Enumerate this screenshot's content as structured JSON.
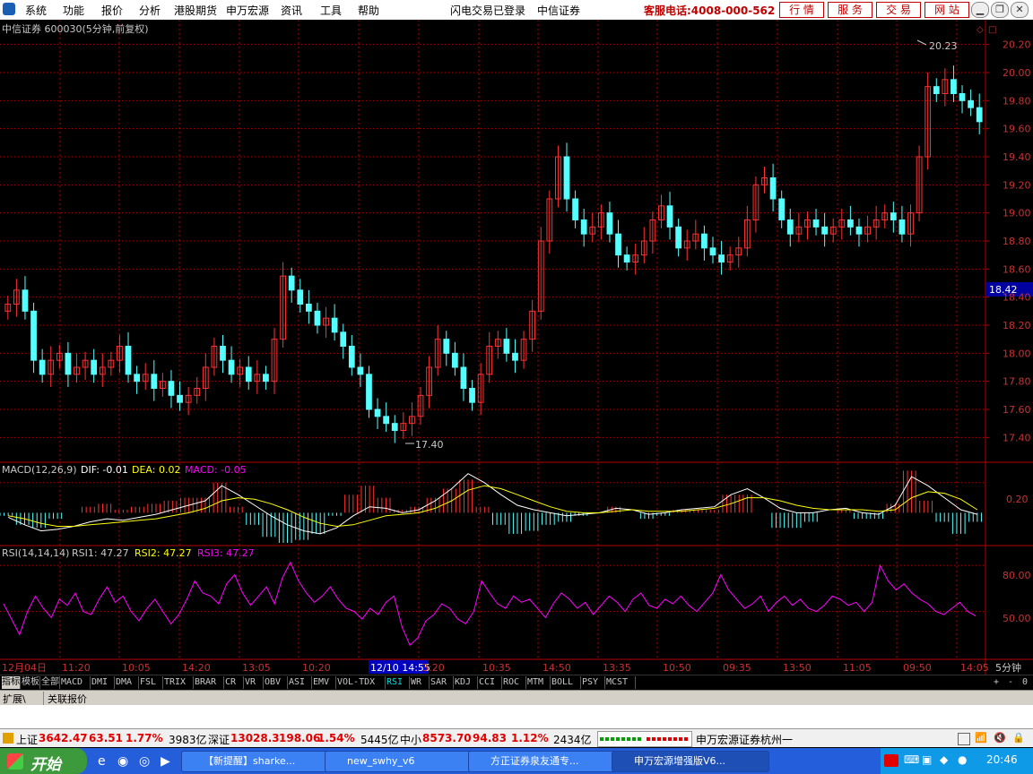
{
  "menu": {
    "items": [
      "系统",
      "功能",
      "报价",
      "分析",
      "港股期货",
      "申万宏源",
      "资讯",
      "工具",
      "帮助"
    ],
    "status": "闪电交易已登录",
    "broker": "中信证券",
    "hotline": "客服电话:4008-000-562",
    "service_buttons": [
      "行 情",
      "服 务",
      "交 易",
      "网 站"
    ]
  },
  "chart_header": "中信证券 600030(5分钟,前复权)",
  "price_panel": {
    "high_label": "20.23",
    "low_label": "17.40",
    "current_label": "18.42",
    "yticks": [
      "20.20",
      "20.00",
      "19.80",
      "19.60",
      "19.40",
      "19.20",
      "19.00",
      "18.80",
      "18.60",
      "18.40",
      "18.20",
      "18.00",
      "17.80",
      "17.60",
      "17.40"
    ]
  },
  "macd_panel": {
    "title": "MACD(12,26,9)",
    "dif": "DIF: -0.01",
    "dea": "DEA: 0.02",
    "macd": "MACD: -0.05",
    "ytick": "0.20"
  },
  "rsi_panel": {
    "title": "RSI(14,14,14)",
    "rsi1": "RSI1: 47.27",
    "rsi2": "RSI2: 47.27",
    "rsi3": "RSI3: 47.27",
    "yticks": [
      "80.00",
      "50.00"
    ]
  },
  "time_axis": {
    "labels": [
      "12月04日",
      "11:20",
      "10:05",
      "14:20",
      "13:05",
      "10:20",
      "12/10 14:55",
      "3:20",
      "10:35",
      "14:50",
      "13:35",
      "10:50",
      "09:35",
      "13:50",
      "11:05",
      "09:50",
      "14:05"
    ],
    "period": "5分钟"
  },
  "indicator_tabs": [
    "指标",
    "模板",
    "全部",
    "MACD",
    "DMI",
    "DMA",
    "FSL",
    "TRIX",
    "BRAR",
    "CR",
    "VR",
    "OBV",
    "ASI",
    "EMV",
    "VOL-TDX",
    "RSI",
    "WR",
    "SAR",
    "KDJ",
    "CCI",
    "ROC",
    "MTM",
    "BOLL",
    "PSY",
    "MCST"
  ],
  "tab_controls": [
    "+",
    "-",
    "0"
  ],
  "sub_tabs": [
    "扩展\\",
    "关联报价"
  ],
  "status_bar": {
    "sh_label": "上证",
    "sh_value": "3642.47",
    "sh_change": "63.51",
    "sh_pct": "1.77%",
    "sh_amount": "3983亿",
    "sz_label": "深证",
    "sz_value": "13028.3",
    "sz_change": "198.06",
    "sz_pct": "1.54%",
    "sz_amount": "5445亿",
    "zx_label": "中小",
    "zx_value": "8573.70",
    "zx_change": "94.83",
    "zx_pct": "1.12%",
    "zx_amount": "2434亿",
    "server": "申万宏源证券杭州一"
  },
  "taskbar": {
    "start": "开始",
    "tasks": [
      "【新提醒】sharke...",
      "new_swhy_v6",
      "方正证券泉友通专...",
      "申万宏源增强版V6..."
    ],
    "clock": "20:46"
  },
  "colors": {
    "up": "#ff3232",
    "down": "#54ffff",
    "grid": "#b40000",
    "axis_text": "#c83232",
    "dif": "#ffffff",
    "dea": "#ffff00",
    "rsi": "#ff00ff"
  },
  "chart_data": {
    "type": "candlestick",
    "price_ylim": [
      17.3,
      20.3
    ],
    "price_series": [
      18.35,
      18.45,
      18.3,
      17.95,
      17.85,
      17.95,
      18.0,
      17.85,
      17.9,
      17.95,
      17.85,
      17.9,
      17.95,
      18.05,
      17.85,
      17.8,
      17.85,
      17.75,
      17.8,
      17.7,
      17.65,
      17.7,
      17.75,
      17.9,
      18.05,
      17.95,
      17.85,
      17.9,
      17.8,
      17.85,
      17.8,
      18.1,
      18.55,
      18.45,
      18.35,
      18.3,
      18.2,
      18.25,
      18.15,
      18.05,
      17.9,
      17.85,
      17.6,
      17.55,
      17.5,
      17.45,
      17.5,
      17.55,
      17.7,
      17.9,
      18.1,
      18.0,
      17.9,
      17.75,
      17.65,
      17.85,
      18.05,
      18.1,
      18.0,
      17.95,
      18.1,
      18.3,
      18.8,
      19.1,
      19.4,
      19.1,
      18.95,
      18.85,
      18.9,
      19.0,
      18.85,
      18.7,
      18.65,
      18.7,
      18.8,
      18.95,
      19.05,
      18.9,
      18.75,
      18.8,
      18.85,
      18.75,
      18.7,
      18.65,
      18.7,
      18.75,
      18.95,
      19.2,
      19.25,
      19.1,
      18.95,
      18.85,
      18.9,
      18.95,
      18.9,
      18.85,
      18.9,
      18.95,
      18.9,
      18.85,
      18.9,
      18.95,
      19.0,
      18.95,
      18.85,
      19.0,
      19.4,
      19.9,
      19.85,
      19.95,
      19.85,
      19.8,
      19.75,
      19.65
    ],
    "macd_ylim": [
      -0.2,
      0.3
    ],
    "dif_series": [
      -0.03,
      -0.08,
      -0.12,
      -0.11,
      -0.09,
      -0.06,
      -0.04,
      -0.05,
      -0.03,
      -0.01,
      0.02,
      0.05,
      0.08,
      0.18,
      0.12,
      0.05,
      -0.02,
      -0.08,
      -0.12,
      -0.14,
      -0.1,
      -0.02,
      0.04,
      0.03,
      0.0,
      0.02,
      0.08,
      0.16,
      0.26,
      0.2,
      0.12,
      0.05,
      0.02,
      0.0,
      -0.02,
      -0.01,
      0.0,
      0.03,
      0.02,
      -0.01,
      0.0,
      0.02,
      0.03,
      0.04,
      0.12,
      0.16,
      0.1,
      0.03,
      0.0,
      0.0,
      0.02,
      0.03,
      0.0,
      -0.01,
      0.05,
      0.24,
      0.18,
      0.1,
      0.02,
      -0.01
    ],
    "dea_series": [
      -0.02,
      -0.04,
      -0.07,
      -0.09,
      -0.09,
      -0.08,
      -0.07,
      -0.06,
      -0.05,
      -0.04,
      -0.02,
      0.0,
      0.03,
      0.08,
      0.1,
      0.09,
      0.06,
      0.02,
      -0.03,
      -0.07,
      -0.09,
      -0.08,
      -0.05,
      -0.02,
      -0.01,
      0.0,
      0.03,
      0.08,
      0.15,
      0.18,
      0.16,
      0.12,
      0.08,
      0.04,
      0.01,
      0.0,
      0.0,
      0.01,
      0.02,
      0.01,
      0.01,
      0.01,
      0.02,
      0.03,
      0.06,
      0.1,
      0.1,
      0.08,
      0.05,
      0.03,
      0.02,
      0.02,
      0.02,
      0.01,
      0.02,
      0.1,
      0.14,
      0.13,
      0.09,
      0.02
    ],
    "rsi_ylim": [
      20,
      90
    ],
    "rsi_series": [
      55,
      45,
      35,
      50,
      60,
      52,
      46,
      58,
      54,
      62,
      50,
      48,
      58,
      66,
      56,
      60,
      50,
      44,
      52,
      58,
      50,
      42,
      48,
      58,
      70,
      62,
      60,
      55,
      68,
      74,
      62,
      54,
      60,
      66,
      55,
      72,
      82,
      70,
      62,
      56,
      60,
      66,
      58,
      52,
      50,
      45,
      52,
      48,
      56,
      60,
      40,
      28,
      33,
      44,
      48,
      55,
      52,
      45,
      42,
      50,
      70,
      62,
      55,
      52,
      60,
      56,
      58,
      52,
      46,
      55,
      62,
      58,
      52,
      56,
      48,
      54,
      60,
      56,
      50,
      58,
      62,
      54,
      52,
      58,
      55,
      60,
      54,
      50,
      56,
      62,
      74,
      64,
      58,
      52,
      55,
      60,
      50,
      56,
      60,
      54,
      58,
      52,
      50,
      54,
      60,
      58,
      54,
      56,
      50,
      56,
      80,
      70,
      64,
      68,
      62,
      58,
      55,
      50,
      48,
      52,
      56,
      50,
      47
    ]
  }
}
